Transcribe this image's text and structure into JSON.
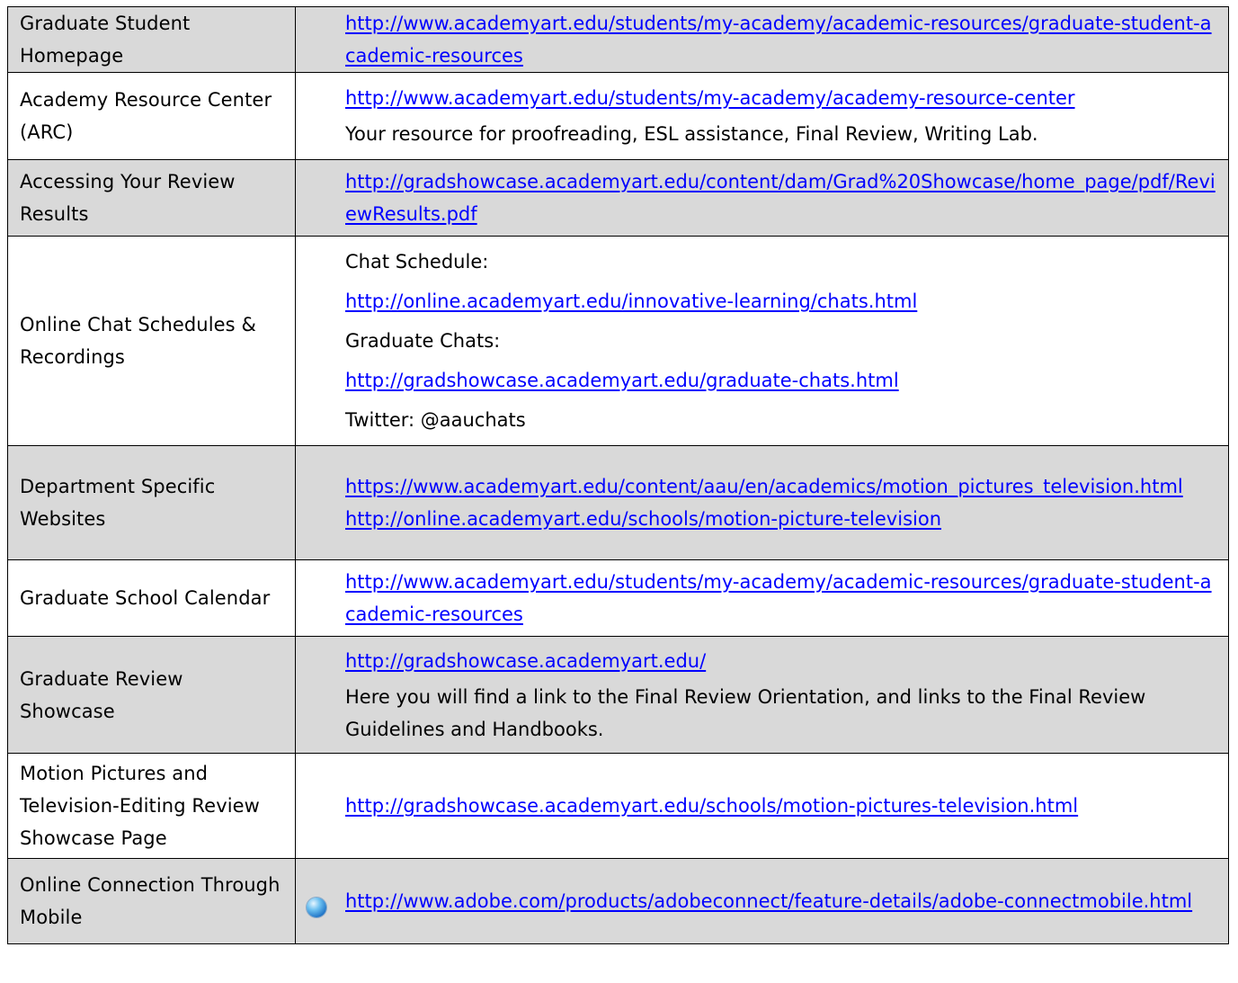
{
  "rows": [
    {
      "label": "Graduate Student Homepage",
      "links": [
        "http://www.academyart.edu/students/my-academy/academic-resources/graduate-student-academic-resources"
      ]
    },
    {
      "label": "Academy Resource Center (ARC)",
      "links": [
        "http://www.academyart.edu/students/my-academy/academy-resource-center"
      ],
      "description": "Your resource for proofreading, ESL assistance, Final Review, Writing Lab."
    },
    {
      "label": "Accessing Your Review Results",
      "links": [
        "http://gradshowcase.academyart.edu/content/dam/Grad%20Showcase/home_page/pdf/ReviewResults.pdf"
      ]
    },
    {
      "label": "Online Chat Schedules & Recordings",
      "chat_schedule_label": "Chat Schedule:",
      "chat_schedule_link": "http://online.academyart.edu/innovative-learning/chats.html",
      "graduate_chats_label": "Graduate Chats:",
      "graduate_chats_link": "http://gradshowcase.academyart.edu/graduate-chats.html",
      "twitter": "Twitter: @aauchats"
    },
    {
      "label": "Department Specific Websites",
      "links": [
        "https://www.academyart.edu/content/aau/en/academics/motion_pictures_television.html",
        "http://online.academyart.edu/schools/motion-picture-television"
      ]
    },
    {
      "label": "Graduate School Calendar",
      "links": [
        "http://www.academyart.edu/students/my-academy/academic-resources/graduate-student-academic-resources"
      ]
    },
    {
      "label": "Graduate Review Showcase",
      "links": [
        "http://gradshowcase.academyart.edu/"
      ],
      "description": "Here you will find a link to the Final Review Orientation, and links to the Final Review Guidelines and Handbooks."
    },
    {
      "label": "Motion Pictures and Television-Editing Review Showcase Page",
      "links": [
        "http://gradshowcase.academyart.edu/schools/motion-pictures-television.html"
      ]
    },
    {
      "label": "Online Connection Through Mobile",
      "links": [
        "http://www.adobe.com/products/adobeconnect/feature-details/adobe-connectmobile.html"
      ],
      "icon": "globe-icon"
    }
  ]
}
